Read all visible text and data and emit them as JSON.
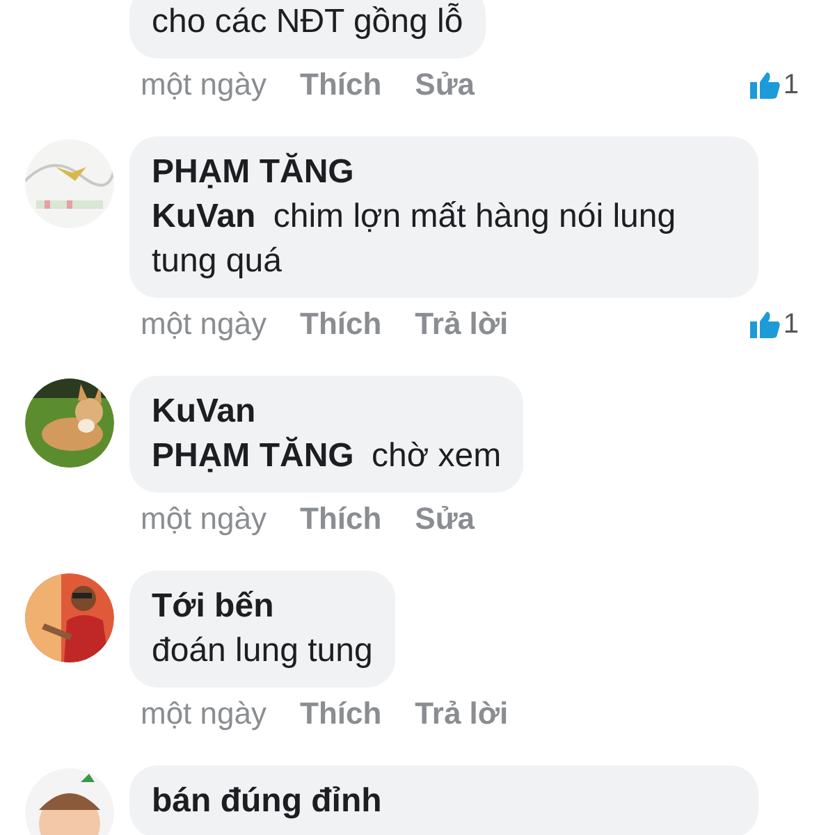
{
  "comments": [
    {
      "text": "cho các NĐT gồng lỗ",
      "time": "một ngày",
      "actions": [
        "Thích",
        "Sửa"
      ],
      "likes": "1"
    },
    {
      "author": "PHẠM TĂNG",
      "mention": "KuVan",
      "text": "chim lợn mất hàng nói lung tung quá",
      "time": "một ngày",
      "actions": [
        "Thích",
        "Trả lời"
      ],
      "likes": "1"
    },
    {
      "author": "KuVan",
      "mention": "PHẠM TĂNG",
      "text": "chờ xem",
      "time": "một ngày",
      "actions": [
        "Thích",
        "Sửa"
      ]
    },
    {
      "author": "Tới bến",
      "text": "đoán lung tung",
      "time": "một ngày",
      "actions": [
        "Thích",
        "Trả lời"
      ]
    },
    {
      "author": "bán đúng đỉnh"
    }
  ]
}
